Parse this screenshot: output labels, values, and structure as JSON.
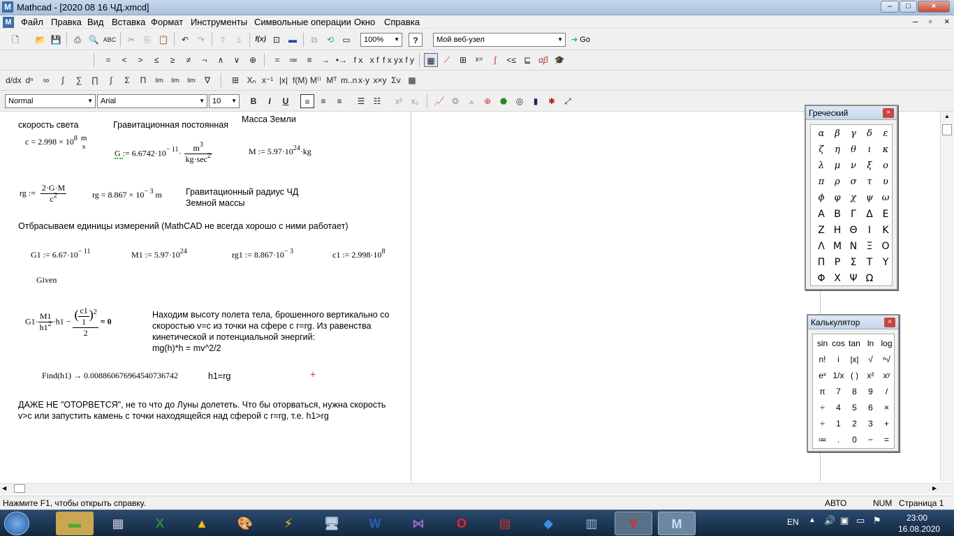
{
  "window": {
    "title": "Mathcad - [2020 08 16 ЧД.xmcd]",
    "app_icon": "M",
    "minimize": "–",
    "maximize": "□",
    "close": "×",
    "doc_minimize": "–",
    "doc_restore": "▫",
    "doc_close": "×"
  },
  "menu": [
    "Файл",
    "Правка",
    "Вид",
    "Вставка",
    "Формат",
    "Инструменты",
    "Символьные операции",
    "Окно",
    "Справка"
  ],
  "toolbar": {
    "zoom": "100%",
    "web": "Мой веб-узел",
    "go": "Go",
    "fx": "f(x)"
  },
  "math_toolbar": [
    "=",
    "<",
    ">",
    "≤",
    "≥",
    "≠",
    "¬",
    "∧",
    "∨",
    "⊕",
    "=",
    "≔",
    "≡",
    "→",
    "•→",
    "f x",
    "x f",
    "f x y",
    "x f y"
  ],
  "format_bar": {
    "style": "Normal",
    "font": "Arial",
    "size": "10",
    "bold": "B",
    "italic": "I",
    "underline": "U"
  },
  "doc": {
    "speed_label": "скорость света",
    "grav_label": "Гравитационная постоянная",
    "mass_label": "Масса Земли",
    "c_def": "c = 2.998 × 10",
    "c_exp": "8",
    "c_unit_n": "m",
    "c_unit_d": "s",
    "g_def": "G := 6.6742·10",
    "g_exp": "− 11",
    "g_unit_n": "m",
    "g_unit_n_exp": "3",
    "g_unit_d": "kg·sec",
    "g_unit_d_exp": "2",
    "m_def": "M := 5.97·10",
    "m_exp": "24",
    "m_unit": "·kg",
    "rg_lhs": "rg :=",
    "rg_num": "2·G·M",
    "rg_den": "c",
    "rg_den_exp": "2",
    "rg_val": "rg = 8.867 × 10",
    "rg_val_exp": "− 3",
    "rg_val_unit": "m",
    "rg_label1": "Гравитационный радиус ЧД",
    "rg_label2": "Земной массы",
    "drop_units": "Отбрасываем единицы измерений (MathCAD не всегда хорошо с ними работает)",
    "g1": "G1 := 6.67·10",
    "g1_exp": "− 11",
    "m1": "M1 := 5.97·10",
    "m1_exp": "24",
    "rg1": "rg1 := 8.867·10",
    "rg1_exp": "− 3",
    "c1": "c1 := 2.998·10",
    "c1_exp": "8",
    "given": "Given",
    "eq_left": "G1·",
    "eq_frac_n": "M1",
    "eq_frac_d": "h1",
    "eq_frac_d_exp": "2",
    "eq_mid": "·h1 −",
    "eq_c1_n": "c1",
    "eq_c1_d": "1",
    "eq_c1_exp": "2",
    "eq_den2": "2",
    "eq_right": "= 0",
    "desc1": "Находим высоту полета тела, брошенного вертикально со",
    "desc2": "скоростью v=c из точки на сфере с r=rg. Из равенства",
    "desc3": "кинетической и потенциальной энергий:",
    "desc4": "mg(h)*h = mv^2/2",
    "find": "Find(h1) → 0.008860676964540736742",
    "h1rg": "h1=rg",
    "conclusion1": "ДАЖЕ НЕ \"ОТОРВЕТСЯ\", не то что  до Луны долететь. Что бы оторваться, нужна скорость",
    "conclusion2": "v>c или запустить камень с точки находящейся над сферой с r=rg, т.е. h1>rg"
  },
  "greek": {
    "title": "Греческий",
    "close": "×",
    "lower": [
      "α",
      "β",
      "γ",
      "δ",
      "ε",
      "ζ",
      "η",
      "θ",
      "ι",
      "κ",
      "λ",
      "μ",
      "ν",
      "ξ",
      "ο",
      "π",
      "ρ",
      "σ",
      "τ",
      "υ",
      "ϕ",
      "φ",
      "χ",
      "ψ",
      "ω"
    ],
    "upper": [
      "Α",
      "Β",
      "Γ",
      "Δ",
      "Ε",
      "Ζ",
      "Η",
      "Θ",
      "Ι",
      "Κ",
      "Λ",
      "Μ",
      "Ν",
      "Ξ",
      "Ο",
      "Π",
      "Ρ",
      "Σ",
      "Τ",
      "Υ",
      "Φ",
      "Χ",
      "Ψ",
      "Ω"
    ]
  },
  "calc": {
    "title": "Калькулятор",
    "close": "×",
    "keys": [
      "sin",
      "cos",
      "tan",
      "ln",
      "log",
      "n!",
      "i",
      "|x|",
      "√",
      "ⁿ√",
      "eˣ",
      "1/x",
      "( )",
      "x²",
      "xʸ",
      "π",
      "7",
      "8",
      "9",
      "/",
      "÷",
      "4",
      "5",
      "6",
      "×",
      "÷",
      "1",
      "2",
      "3",
      "+",
      "≔",
      ".",
      "0",
      "−",
      "="
    ]
  },
  "status": {
    "help": "Нажмите F1, чтобы открыть справку.",
    "mode": "АВТО",
    "num": "NUM",
    "page": "Страница 1"
  },
  "taskbar": {
    "lang": "EN",
    "time": "23:00",
    "date": "16.08.2020"
  }
}
